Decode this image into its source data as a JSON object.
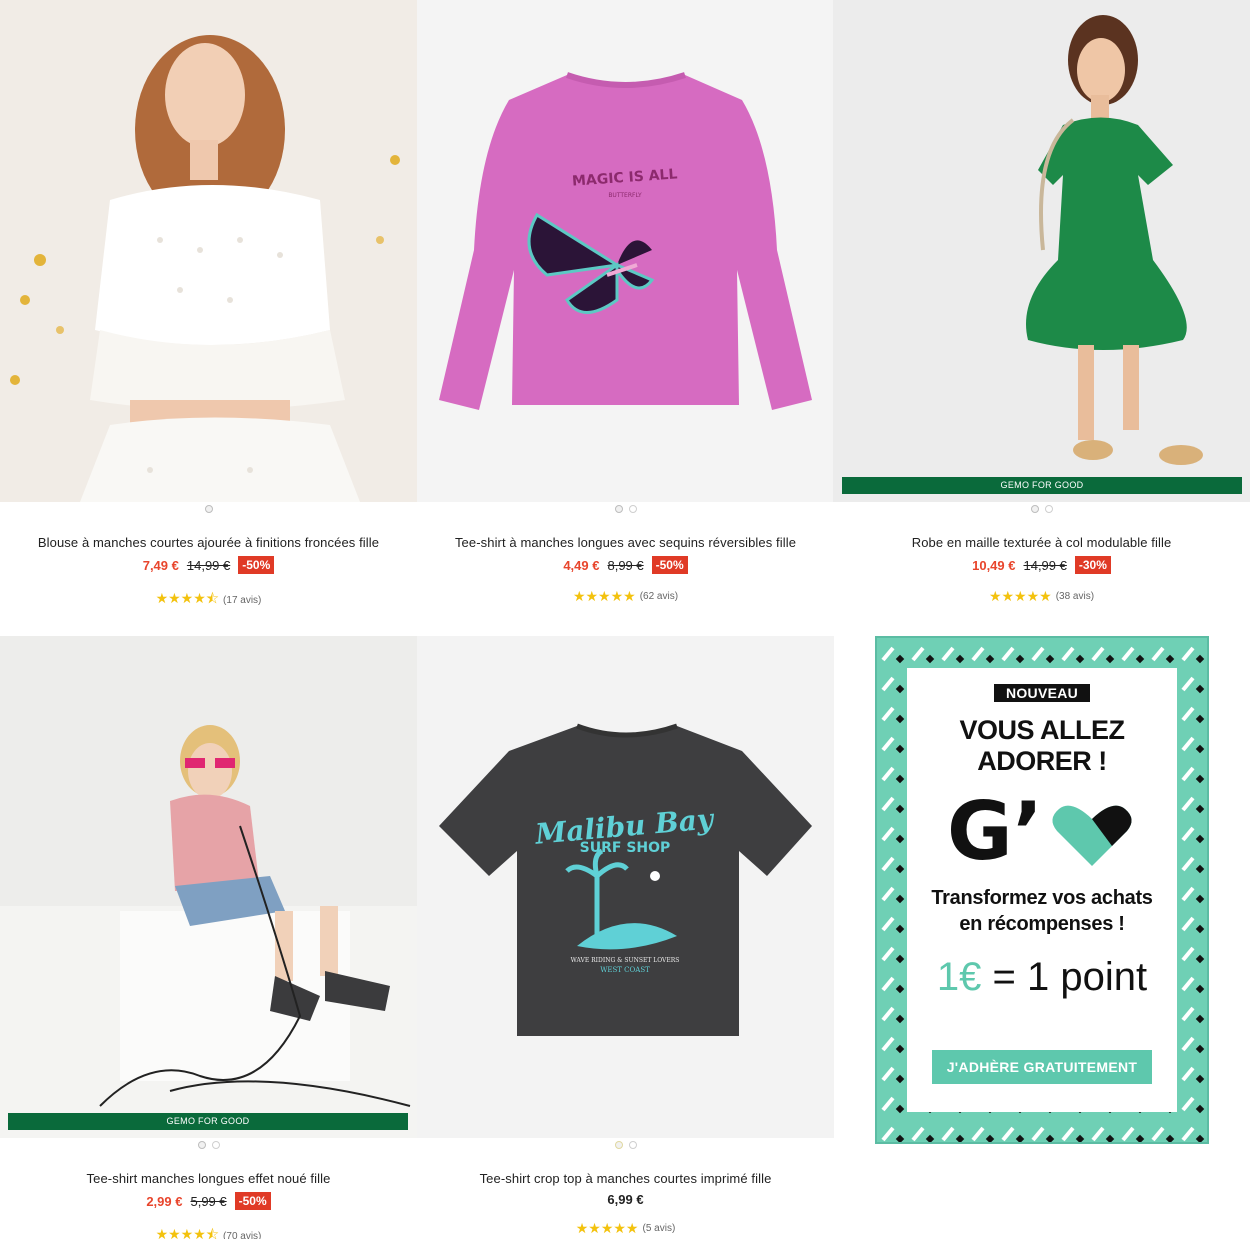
{
  "colors": {
    "discount": "#e03a26",
    "price_sale": "#e8452c",
    "stars": "#f3c20e",
    "good_badge": "#0a6a3b",
    "promo_mint": "#5ec8ad"
  },
  "products": [
    {
      "title": "Blouse à manches courtes ajourée à finitions froncées fille",
      "price": "7,49 €",
      "old_price": "14,99 €",
      "discount": "-50%",
      "stars": "★★★★⯪",
      "reviews": "(17 avis)",
      "badge": ""
    },
    {
      "title": "Tee-shirt à manches longues avec sequins réversibles fille",
      "price": "4,49 €",
      "old_price": "8,99 €",
      "discount": "-50%",
      "stars": "★★★★★",
      "reviews": "(62 avis)",
      "badge": "",
      "print_text": "MAGIC IS ALL",
      "print_sub": "BUTTERFLY"
    },
    {
      "title": "Robe en maille texturée à col modulable fille",
      "price": "10,49 €",
      "old_price": "14,99 €",
      "discount": "-30%",
      "stars": "★★★★★",
      "reviews": "(38 avis)",
      "badge": "GEMO FOR GOOD"
    },
    {
      "title": "Tee-shirt manches longues effet noué fille",
      "price": "2,99 €",
      "old_price": "5,99 €",
      "discount": "-50%",
      "stars": "★★★★⯪",
      "reviews": "(70 avis)",
      "badge": "GEMO FOR GOOD"
    },
    {
      "title": "Tee-shirt crop top à manches courtes imprimé fille",
      "price": "6,99 €",
      "old_price": "",
      "discount": "",
      "stars": "★★★★★",
      "reviews": "(5 avis)",
      "badge": "",
      "print_text": "Malibu Bay",
      "print_sub": "SURF SHOP",
      "print_line": "WAVE RIDING & SUNSET LOVERS",
      "print_line2": "WEST COAST"
    }
  ],
  "promo": {
    "tag": "NOUVEAU",
    "headline_1": "VOUS ALLEZ",
    "headline_2": "ADORER !",
    "logo": "G’",
    "sub_1": "Transformez vos achats",
    "sub_2": "en récompenses !",
    "points_a": "1€",
    "points_b": " = 1 point",
    "cta": "J'ADHÈRE GRATUITEMENT"
  }
}
